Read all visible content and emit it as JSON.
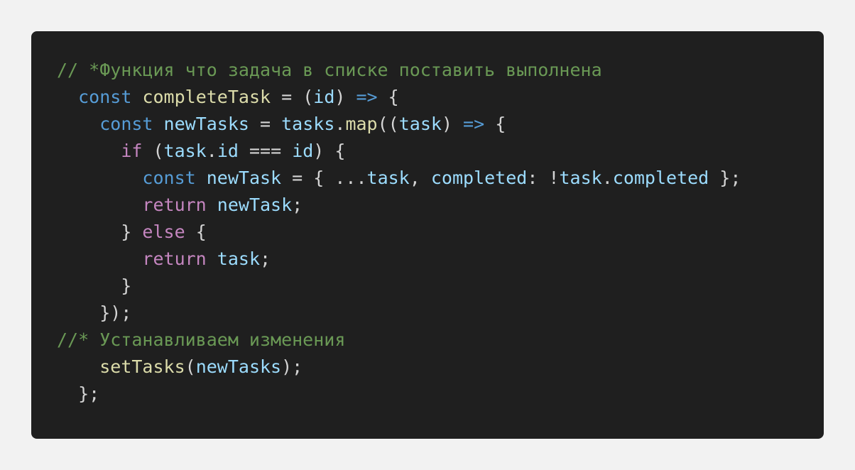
{
  "colors": {
    "page_background": "#f2f2f2",
    "card_background": "#1f1f1f",
    "comment": "#6a9955",
    "storage": "#569cd6",
    "function": "#dcdcaa",
    "variable": "#9cdcfe",
    "control": "#c586c0",
    "punctuation": "#d4d4d4"
  },
  "code": {
    "lines": [
      [
        {
          "t": "// *Функция что задача в списке поставить выполнена",
          "c": "comment"
        }
      ],
      [
        {
          "t": "  "
        },
        {
          "t": "const",
          "c": "storage"
        },
        {
          "t": " "
        },
        {
          "t": "completeTask",
          "c": "func"
        },
        {
          "t": " = ("
        },
        {
          "t": "id",
          "c": "var"
        },
        {
          "t": ") "
        },
        {
          "t": "=>",
          "c": "arrow"
        },
        {
          "t": " {"
        }
      ],
      [
        {
          "t": "    "
        },
        {
          "t": "const",
          "c": "storage"
        },
        {
          "t": " "
        },
        {
          "t": "newTasks",
          "c": "var"
        },
        {
          "t": " = "
        },
        {
          "t": "tasks",
          "c": "var"
        },
        {
          "t": "."
        },
        {
          "t": "map",
          "c": "func"
        },
        {
          "t": "(("
        },
        {
          "t": "task",
          "c": "var"
        },
        {
          "t": ") "
        },
        {
          "t": "=>",
          "c": "arrow"
        },
        {
          "t": " {"
        }
      ],
      [
        {
          "t": "      "
        },
        {
          "t": "if",
          "c": "control"
        },
        {
          "t": " ("
        },
        {
          "t": "task",
          "c": "var"
        },
        {
          "t": "."
        },
        {
          "t": "id",
          "c": "var"
        },
        {
          "t": " === "
        },
        {
          "t": "id",
          "c": "var"
        },
        {
          "t": ") {"
        }
      ],
      [
        {
          "t": "        "
        },
        {
          "t": "const",
          "c": "storage"
        },
        {
          "t": " "
        },
        {
          "t": "newTask",
          "c": "var"
        },
        {
          "t": " = { ..."
        },
        {
          "t": "task",
          "c": "var"
        },
        {
          "t": ", "
        },
        {
          "t": "completed",
          "c": "var"
        },
        {
          "t": ": !"
        },
        {
          "t": "task",
          "c": "var"
        },
        {
          "t": "."
        },
        {
          "t": "completed",
          "c": "var"
        },
        {
          "t": " };"
        }
      ],
      [
        {
          "t": "        "
        },
        {
          "t": "return",
          "c": "control"
        },
        {
          "t": " "
        },
        {
          "t": "newTask",
          "c": "var"
        },
        {
          "t": ";"
        }
      ],
      [
        {
          "t": "      } "
        },
        {
          "t": "else",
          "c": "control"
        },
        {
          "t": " {"
        }
      ],
      [
        {
          "t": "        "
        },
        {
          "t": "return",
          "c": "control"
        },
        {
          "t": " "
        },
        {
          "t": "task",
          "c": "var"
        },
        {
          "t": ";"
        }
      ],
      [
        {
          "t": "      }"
        }
      ],
      [
        {
          "t": "    });"
        }
      ],
      [
        {
          "t": "//* Устанавливаем изменения",
          "c": "comment"
        }
      ],
      [
        {
          "t": "    "
        },
        {
          "t": "setTasks",
          "c": "func"
        },
        {
          "t": "("
        },
        {
          "t": "newTasks",
          "c": "var"
        },
        {
          "t": ");"
        }
      ],
      [
        {
          "t": "  };"
        }
      ]
    ]
  }
}
